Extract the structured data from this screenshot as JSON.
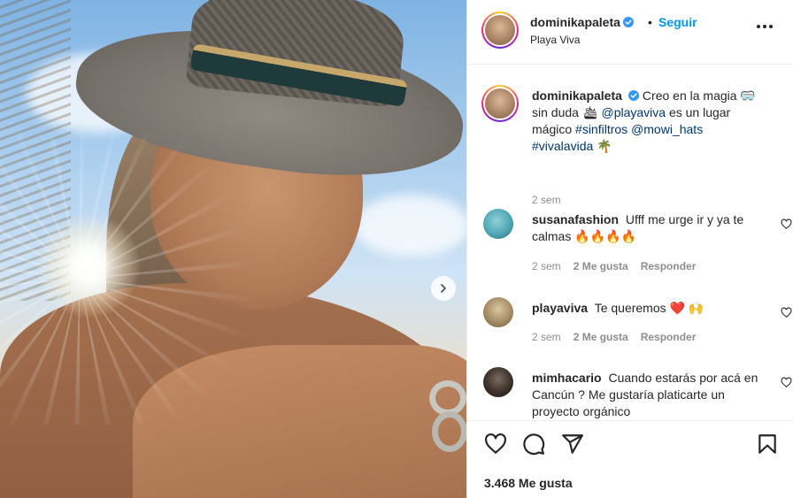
{
  "header": {
    "username": "dominikapaleta",
    "separator": "•",
    "follow_label": "Seguir",
    "location": "Playa Viva"
  },
  "caption": {
    "username": "dominikapaleta",
    "text_1": "Creo en la magia 🥽 sin duda 🛳",
    "mention_1": "@playaviva",
    "text_2": "es un lugar mágico",
    "tag_1": "#sinfiltros",
    "mention_2": "@mowi_hats",
    "tag_2": "#vivalavida",
    "emoji_end": "🌴",
    "time": "2 sem"
  },
  "comments": [
    {
      "username": "susanafashion",
      "text": "Ufff me urge ir y ya te calmas 🔥🔥🔥🔥",
      "time": "2 sem",
      "likes": "2 Me gusta",
      "reply": "Responder"
    },
    {
      "username": "playaviva",
      "text": "Te queremos ❤️ 🙌",
      "time": "2 sem",
      "likes": "2 Me gusta",
      "reply": "Responder"
    },
    {
      "username": "mimhacario",
      "text": "Cuando estarás por acá en Cancún ? Me gustaría platicarte un proyecto orgánico"
    }
  ],
  "footer": {
    "likes_count": "3.468 Me gusta"
  },
  "icons": {
    "heart": "heart-icon",
    "comment": "comment-icon",
    "share": "share-icon",
    "save": "bookmark-icon",
    "more": "more-options-icon",
    "next": "chevron-right-icon",
    "verified": "verified-badge-icon"
  },
  "colors": {
    "accent": "#0095f6",
    "link": "#00376b",
    "muted": "#8e8e8e",
    "text": "#262626"
  }
}
